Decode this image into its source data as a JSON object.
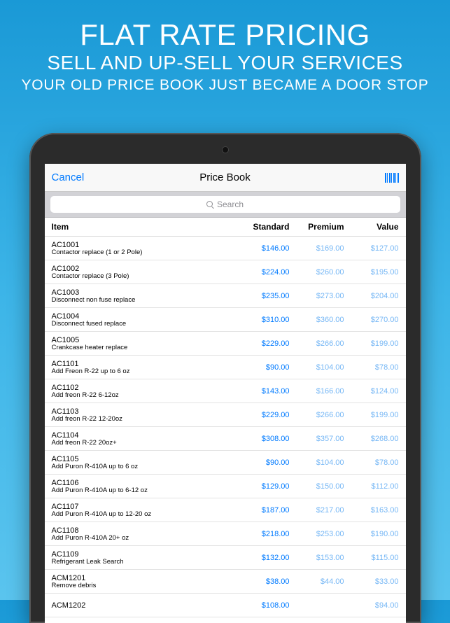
{
  "promo": {
    "line1": "FLAT RATE PRICING",
    "line2": "SELL AND UP-SELL YOUR SERVICES",
    "line3": "YOUR OLD PRICE BOOK JUST BECAME A DOOR STOP"
  },
  "navbar": {
    "cancel": "Cancel",
    "title": "Price Book"
  },
  "search": {
    "placeholder": "Search"
  },
  "columns": {
    "item": "Item",
    "standard": "Standard",
    "premium": "Premium",
    "value": "Value"
  },
  "rows": [
    {
      "code": "AC1001",
      "desc": "Contactor replace (1 or 2 Pole)",
      "standard": "$146.00",
      "premium": "$169.00",
      "value": "$127.00"
    },
    {
      "code": "AC1002",
      "desc": "Contactor replace (3 Pole)",
      "standard": "$224.00",
      "premium": "$260.00",
      "value": "$195.00"
    },
    {
      "code": "AC1003",
      "desc": "Disconnect non fuse replace",
      "standard": "$235.00",
      "premium": "$273.00",
      "value": "$204.00"
    },
    {
      "code": "AC1004",
      "desc": "Disconnect fused replace",
      "standard": "$310.00",
      "premium": "$360.00",
      "value": "$270.00"
    },
    {
      "code": "AC1005",
      "desc": "Crankcase heater replace",
      "standard": "$229.00",
      "premium": "$266.00",
      "value": "$199.00"
    },
    {
      "code": "AC1101",
      "desc": "Add Freon R-22 up to 6 oz",
      "standard": "$90.00",
      "premium": "$104.00",
      "value": "$78.00"
    },
    {
      "code": "AC1102",
      "desc": "Add freon R-22 6-12oz",
      "standard": "$143.00",
      "premium": "$166.00",
      "value": "$124.00"
    },
    {
      "code": "AC1103",
      "desc": "Add freon R-22 12-20oz",
      "standard": "$229.00",
      "premium": "$266.00",
      "value": "$199.00"
    },
    {
      "code": "AC1104",
      "desc": "Add freon R-22 20oz+",
      "standard": "$308.00",
      "premium": "$357.00",
      "value": "$268.00"
    },
    {
      "code": "AC1105",
      "desc": "Add Puron R-410A up to 6 oz",
      "standard": "$90.00",
      "premium": "$104.00",
      "value": "$78.00"
    },
    {
      "code": "AC1106",
      "desc": "Add Puron R-410A up to 6-12 oz",
      "standard": "$129.00",
      "premium": "$150.00",
      "value": "$112.00"
    },
    {
      "code": "AC1107",
      "desc": "Add Puron R-410A up to 12-20 oz",
      "standard": "$187.00",
      "premium": "$217.00",
      "value": "$163.00"
    },
    {
      "code": "AC1108",
      "desc": "Add Puron R-410A 20+ oz",
      "standard": "$218.00",
      "premium": "$253.00",
      "value": "$190.00"
    },
    {
      "code": "AC1109",
      "desc": "Refrigerant Leak Search",
      "standard": "$132.00",
      "premium": "$153.00",
      "value": "$115.00"
    },
    {
      "code": "ACM1201",
      "desc": "Remove debris",
      "standard": "$38.00",
      "premium": "$44.00",
      "value": "$33.00"
    },
    {
      "code": "ACM1202",
      "desc": "",
      "standard": "$108.00",
      "premium": "",
      "value": "$94.00"
    }
  ]
}
